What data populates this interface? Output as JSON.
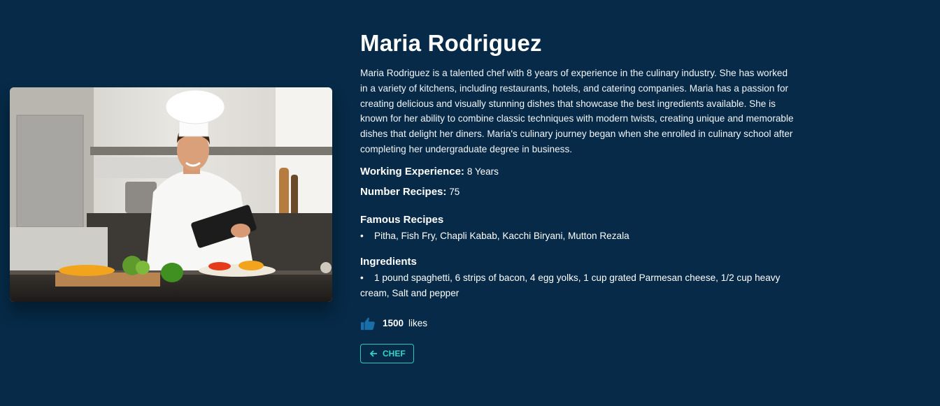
{
  "chef": {
    "name": "Maria Rodriguez",
    "bio": "Maria Rodriguez is a talented chef with 8 years of experience in the culinary industry. She has worked in a variety of kitchens, including restaurants, hotels, and catering companies. Maria has a passion for creating delicious and visually stunning dishes that showcase the best ingredients available. She is known for her ability to combine classic techniques with modern twists, creating unique and memorable dishes that delight her diners. Maria's culinary journey began when she enrolled in culinary school after completing her undergraduate degree in business.",
    "experience_label": "Working Experience:",
    "experience_value": "8 Years",
    "recipes_label": "Number Recipes:",
    "recipes_value": "75",
    "famous_title": "Famous Recipes",
    "famous_recipes": [
      "Pitha, Fish Fry, Chapli Kabab, Kacchi Biryani, Mutton Rezala"
    ],
    "ingredients_title": "Ingredients",
    "ingredients": [
      "1 pound spaghetti, 6 strips of bacon, 4 egg yolks, 1 cup grated Parmesan cheese, 1/2 cup heavy cream, Salt and pepper"
    ],
    "likes_count": "1500",
    "likes_label": "likes",
    "back_label": "CHEF",
    "photo_icon": "chef-photo"
  },
  "colors": {
    "background": "#062a47",
    "accent": "#2fc6bd",
    "like_icon": "#1b6fa8"
  }
}
